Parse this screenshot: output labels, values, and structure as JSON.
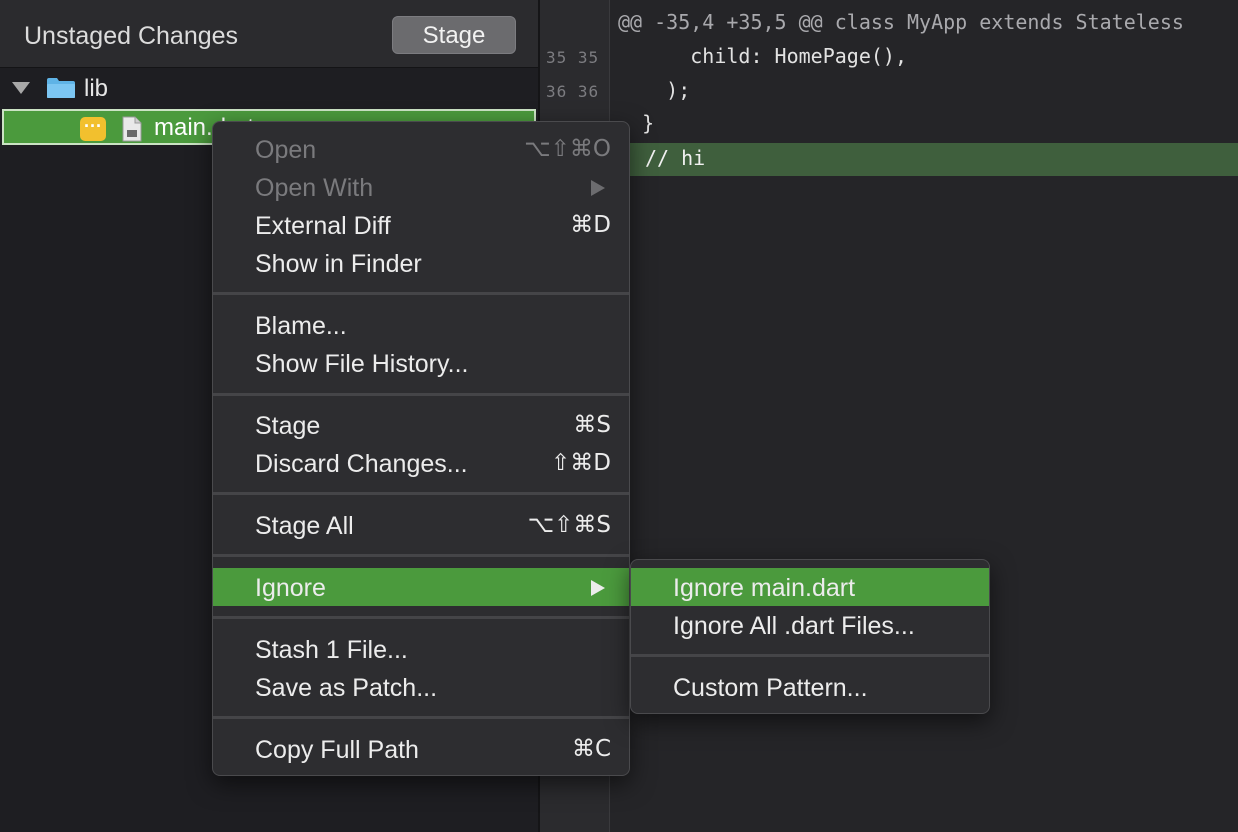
{
  "left_pane": {
    "title": "Unstaged Changes",
    "stage_button": "Stage",
    "tree": {
      "folder": "lib",
      "file": "main.dart",
      "file_badge": "···"
    }
  },
  "diff": {
    "hunk_header": "@@ -35,4 +35,5 @@ class MyApp extends Stateless",
    "gutter": [
      {
        "old": "35",
        "new": "35"
      },
      {
        "old": "36",
        "new": "36"
      }
    ],
    "lines": [
      "      child: HomePage(),",
      "    );",
      "  }"
    ],
    "added_line": "// hi"
  },
  "context_menu": {
    "items": [
      {
        "label": "Open",
        "shortcut": "⌥⇧⌘O",
        "disabled": true
      },
      {
        "label": "Open With",
        "shortcut": "",
        "disabled": true,
        "submenu": true
      },
      {
        "label": "External Diff",
        "shortcut": "⌘D"
      },
      {
        "label": "Show in Finder",
        "shortcut": ""
      },
      {
        "label": "Blame...",
        "shortcut": ""
      },
      {
        "label": "Show File History...",
        "shortcut": ""
      },
      {
        "label": "Stage",
        "shortcut": "⌘S"
      },
      {
        "label": "Discard Changes...",
        "shortcut": "⇧⌘D"
      },
      {
        "label": "Stage All",
        "shortcut": "⌥⇧⌘S"
      },
      {
        "label": "Ignore",
        "shortcut": "",
        "submenu": true,
        "active": true
      },
      {
        "label": "Stash 1 File...",
        "shortcut": ""
      },
      {
        "label": "Save as Patch...",
        "shortcut": ""
      },
      {
        "label": "Copy Full Path",
        "shortcut": "⌘C"
      }
    ]
  },
  "submenu": {
    "items": [
      {
        "label": "Ignore main.dart",
        "active": true
      },
      {
        "label": "Ignore All .dart Files..."
      },
      {
        "label": "Custom Pattern..."
      }
    ]
  },
  "colors": {
    "accent_green": "#4b9a3d",
    "added_line_bg": "#3f5f3d",
    "badge_yellow": "#f2c02e"
  }
}
